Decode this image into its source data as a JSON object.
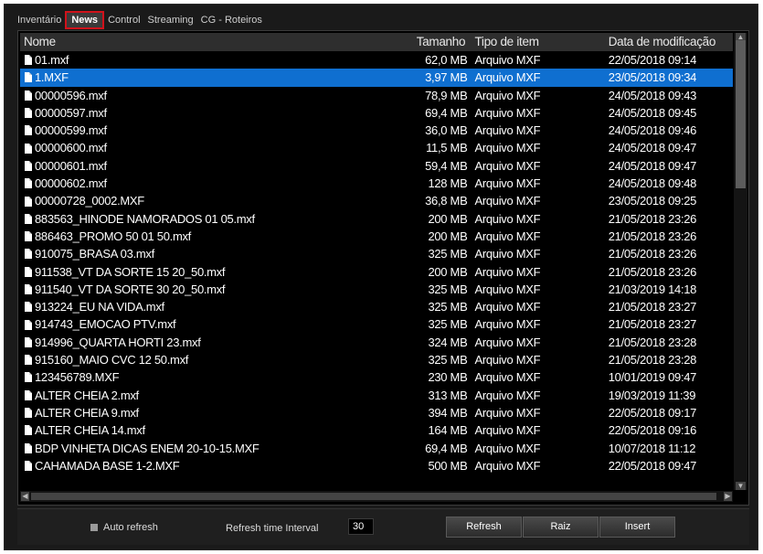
{
  "tabs": [
    "Inventário",
    "News",
    "Control",
    "Streaming",
    "CG - Roteiros"
  ],
  "active_tab": "News",
  "columns": {
    "name": "Nome",
    "size": "Tamanho",
    "type": "Tipo de item",
    "date": "Data de modificação"
  },
  "rows": [
    {
      "name": "01.mxf",
      "size": "62,0 MB",
      "type": "Arquivo MXF",
      "date": "22/05/2018 09:14"
    },
    {
      "name": "1.MXF",
      "size": "3,97 MB",
      "type": "Arquivo MXF",
      "date": "23/05/2018 09:34",
      "selected": true
    },
    {
      "name": "00000596.mxf",
      "size": "78,9 MB",
      "type": "Arquivo MXF",
      "date": "24/05/2018 09:43"
    },
    {
      "name": "00000597.mxf",
      "size": "69,4 MB",
      "type": "Arquivo MXF",
      "date": "24/05/2018 09:45"
    },
    {
      "name": "00000599.mxf",
      "size": "36,0 MB",
      "type": "Arquivo MXF",
      "date": "24/05/2018 09:46"
    },
    {
      "name": "00000600.mxf",
      "size": "11,5 MB",
      "type": "Arquivo MXF",
      "date": "24/05/2018 09:47"
    },
    {
      "name": "00000601.mxf",
      "size": "59,4 MB",
      "type": "Arquivo MXF",
      "date": "24/05/2018 09:47"
    },
    {
      "name": "00000602.mxf",
      "size": "128 MB",
      "type": "Arquivo MXF",
      "date": "24/05/2018 09:48"
    },
    {
      "name": "00000728_0002.MXF",
      "size": "36,8 MB",
      "type": "Arquivo MXF",
      "date": "23/05/2018 09:25"
    },
    {
      "name": "883563_HINODE NAMORADOS 01 05.mxf",
      "size": "200 MB",
      "type": "Arquivo MXF",
      "date": "21/05/2018 23:26"
    },
    {
      "name": "886463_PROMO 50 01 50.mxf",
      "size": "200 MB",
      "type": "Arquivo MXF",
      "date": "21/05/2018 23:26"
    },
    {
      "name": "910075_BRASA 03.mxf",
      "size": "325 MB",
      "type": "Arquivo MXF",
      "date": "21/05/2018 23:26"
    },
    {
      "name": "911538_VT DA SORTE 15 20_50.mxf",
      "size": "200 MB",
      "type": "Arquivo MXF",
      "date": "21/05/2018 23:26"
    },
    {
      "name": "911540_VT DA SORTE 30 20_50.mxf",
      "size": "325 MB",
      "type": "Arquivo MXF",
      "date": "21/03/2019 14:18"
    },
    {
      "name": "913224_EU NA VIDA.mxf",
      "size": "325 MB",
      "type": "Arquivo MXF",
      "date": "21/05/2018 23:27"
    },
    {
      "name": "914743_EMOCAO PTV.mxf",
      "size": "325 MB",
      "type": "Arquivo MXF",
      "date": "21/05/2018 23:27"
    },
    {
      "name": "914996_QUARTA HORTI 23.mxf",
      "size": "324 MB",
      "type": "Arquivo MXF",
      "date": "21/05/2018 23:28"
    },
    {
      "name": "915160_MAIO CVC 12 50.mxf",
      "size": "325 MB",
      "type": "Arquivo MXF",
      "date": "21/05/2018 23:28"
    },
    {
      "name": "123456789.MXF",
      "size": "230 MB",
      "type": "Arquivo MXF",
      "date": "10/01/2019 09:47"
    },
    {
      "name": "ALTER CHEIA 2.mxf",
      "size": "313 MB",
      "type": "Arquivo MXF",
      "date": "19/03/2019 11:39"
    },
    {
      "name": "ALTER CHEIA 9.mxf",
      "size": "394 MB",
      "type": "Arquivo MXF",
      "date": "22/05/2018 09:17"
    },
    {
      "name": "ALTER CHEIA 14.mxf",
      "size": "164 MB",
      "type": "Arquivo MXF",
      "date": "22/05/2018 09:16"
    },
    {
      "name": "BDP VINHETA DICAS ENEM  20-10-15.MXF",
      "size": "69,4 MB",
      "type": "Arquivo MXF",
      "date": "10/07/2018 11:12"
    },
    {
      "name": "CAHAMADA BASE 1-2.MXF",
      "size": "500 MB",
      "type": "Arquivo MXF",
      "date": "22/05/2018 09:47"
    }
  ],
  "footer": {
    "auto_refresh_label": "Auto refresh",
    "interval_label": "Refresh time Interval",
    "interval_value": "30",
    "refresh_button": "Refresh",
    "raiz_button": "Raiz",
    "insert_button": "Insert"
  },
  "colors": {
    "selection": "#0f6fd0",
    "active_tab_border": "#d0121b",
    "background": "#000000"
  }
}
